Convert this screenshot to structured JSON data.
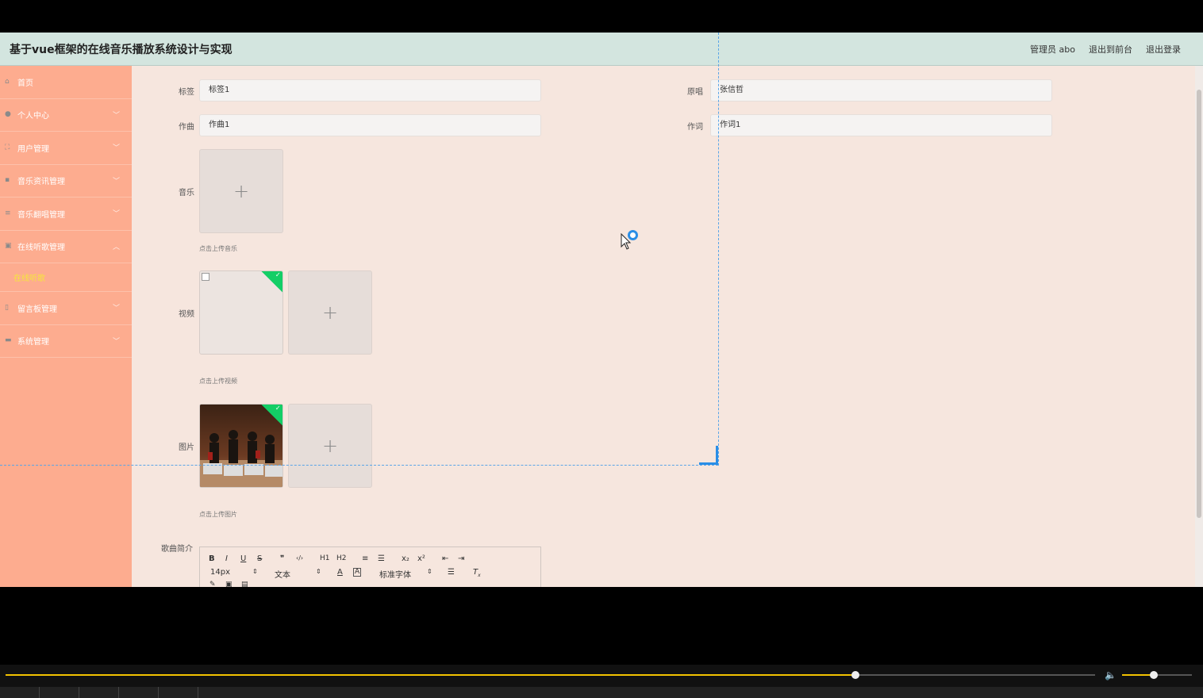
{
  "header": {
    "title": "基于vue框架的在线音乐播放系统设计与实现",
    "admin_label": "管理员 abo",
    "back_to_front": "退出到前台",
    "logout": "退出登录"
  },
  "sidebar": {
    "items": [
      {
        "label": "首页",
        "icon": "home-icon"
      },
      {
        "label": "个人中心",
        "icon": "user-icon"
      },
      {
        "label": "用户管理",
        "icon": "users-icon"
      },
      {
        "label": "音乐资讯管理",
        "icon": "news-icon"
      },
      {
        "label": "音乐翻唱管理",
        "icon": "list-icon"
      },
      {
        "label": "在线听歌管理",
        "icon": "clipboard-icon"
      },
      {
        "label": "留言板管理",
        "icon": "mic-icon"
      },
      {
        "label": "系统管理",
        "icon": "message-icon"
      }
    ],
    "sub_item": "在线听歌"
  },
  "form": {
    "tag_label": "标签",
    "tag_value": "标签1",
    "singer_label": "原唱",
    "singer_value": "张信哲",
    "composer_label": "作曲",
    "composer_value": "作曲1",
    "lyricist_label": "作词",
    "lyricist_value": "作词1",
    "music_label": "音乐",
    "music_hint": "点击上传音乐",
    "video_label": "视频",
    "video_hint": "点击上传视频",
    "image_label": "图片",
    "image_hint": "点击上传图片",
    "intro_label": "歌曲简介"
  },
  "editor_toolbar": {
    "font_size": "14px",
    "text_style": "文本",
    "font_family": "标准字体",
    "buttons": [
      "B",
      "I",
      "U",
      "S",
      "❞",
      "‹/›",
      "H1",
      "H2",
      "≡",
      "☰",
      "x₂",
      "x²",
      "⇤",
      "⇥"
    ]
  },
  "player": {
    "progress": 0.78,
    "volume": 0.45
  }
}
